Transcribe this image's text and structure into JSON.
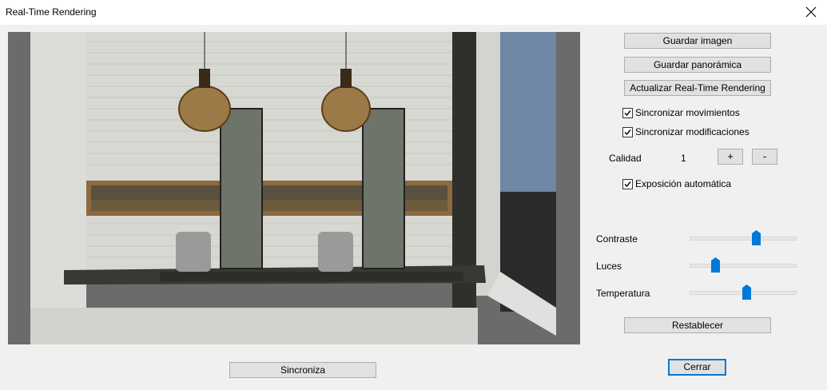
{
  "window": {
    "title": "Real-Time Rendering",
    "close_icon": "close-icon"
  },
  "buttons": {
    "save_image": "Guardar imagen",
    "save_panoramic": "Guardar panorámica",
    "update_rendering": "Actualizar Real-Time Rendering",
    "reset": "Restablecer",
    "sync": "Sincroniza",
    "close": "Cerrar"
  },
  "checkboxes": {
    "sync_movements": {
      "label": "Sincronizar movimientos",
      "checked": true
    },
    "sync_modifications": {
      "label": "Sincronizar modificaciones",
      "checked": true
    },
    "auto_exposure": {
      "label": "Exposición automática",
      "checked": true
    }
  },
  "quality": {
    "label": "Calidad",
    "value": "1",
    "plus": "+",
    "minus": "-"
  },
  "sliders": {
    "contrast": {
      "label": "Contraste",
      "value": 0.62
    },
    "lights": {
      "label": "Luces",
      "value": 0.24
    },
    "temperature": {
      "label": "Temperatura",
      "value": 0.53
    }
  },
  "colors": {
    "accent": "#0078d7",
    "thumb": "#0078d7"
  }
}
